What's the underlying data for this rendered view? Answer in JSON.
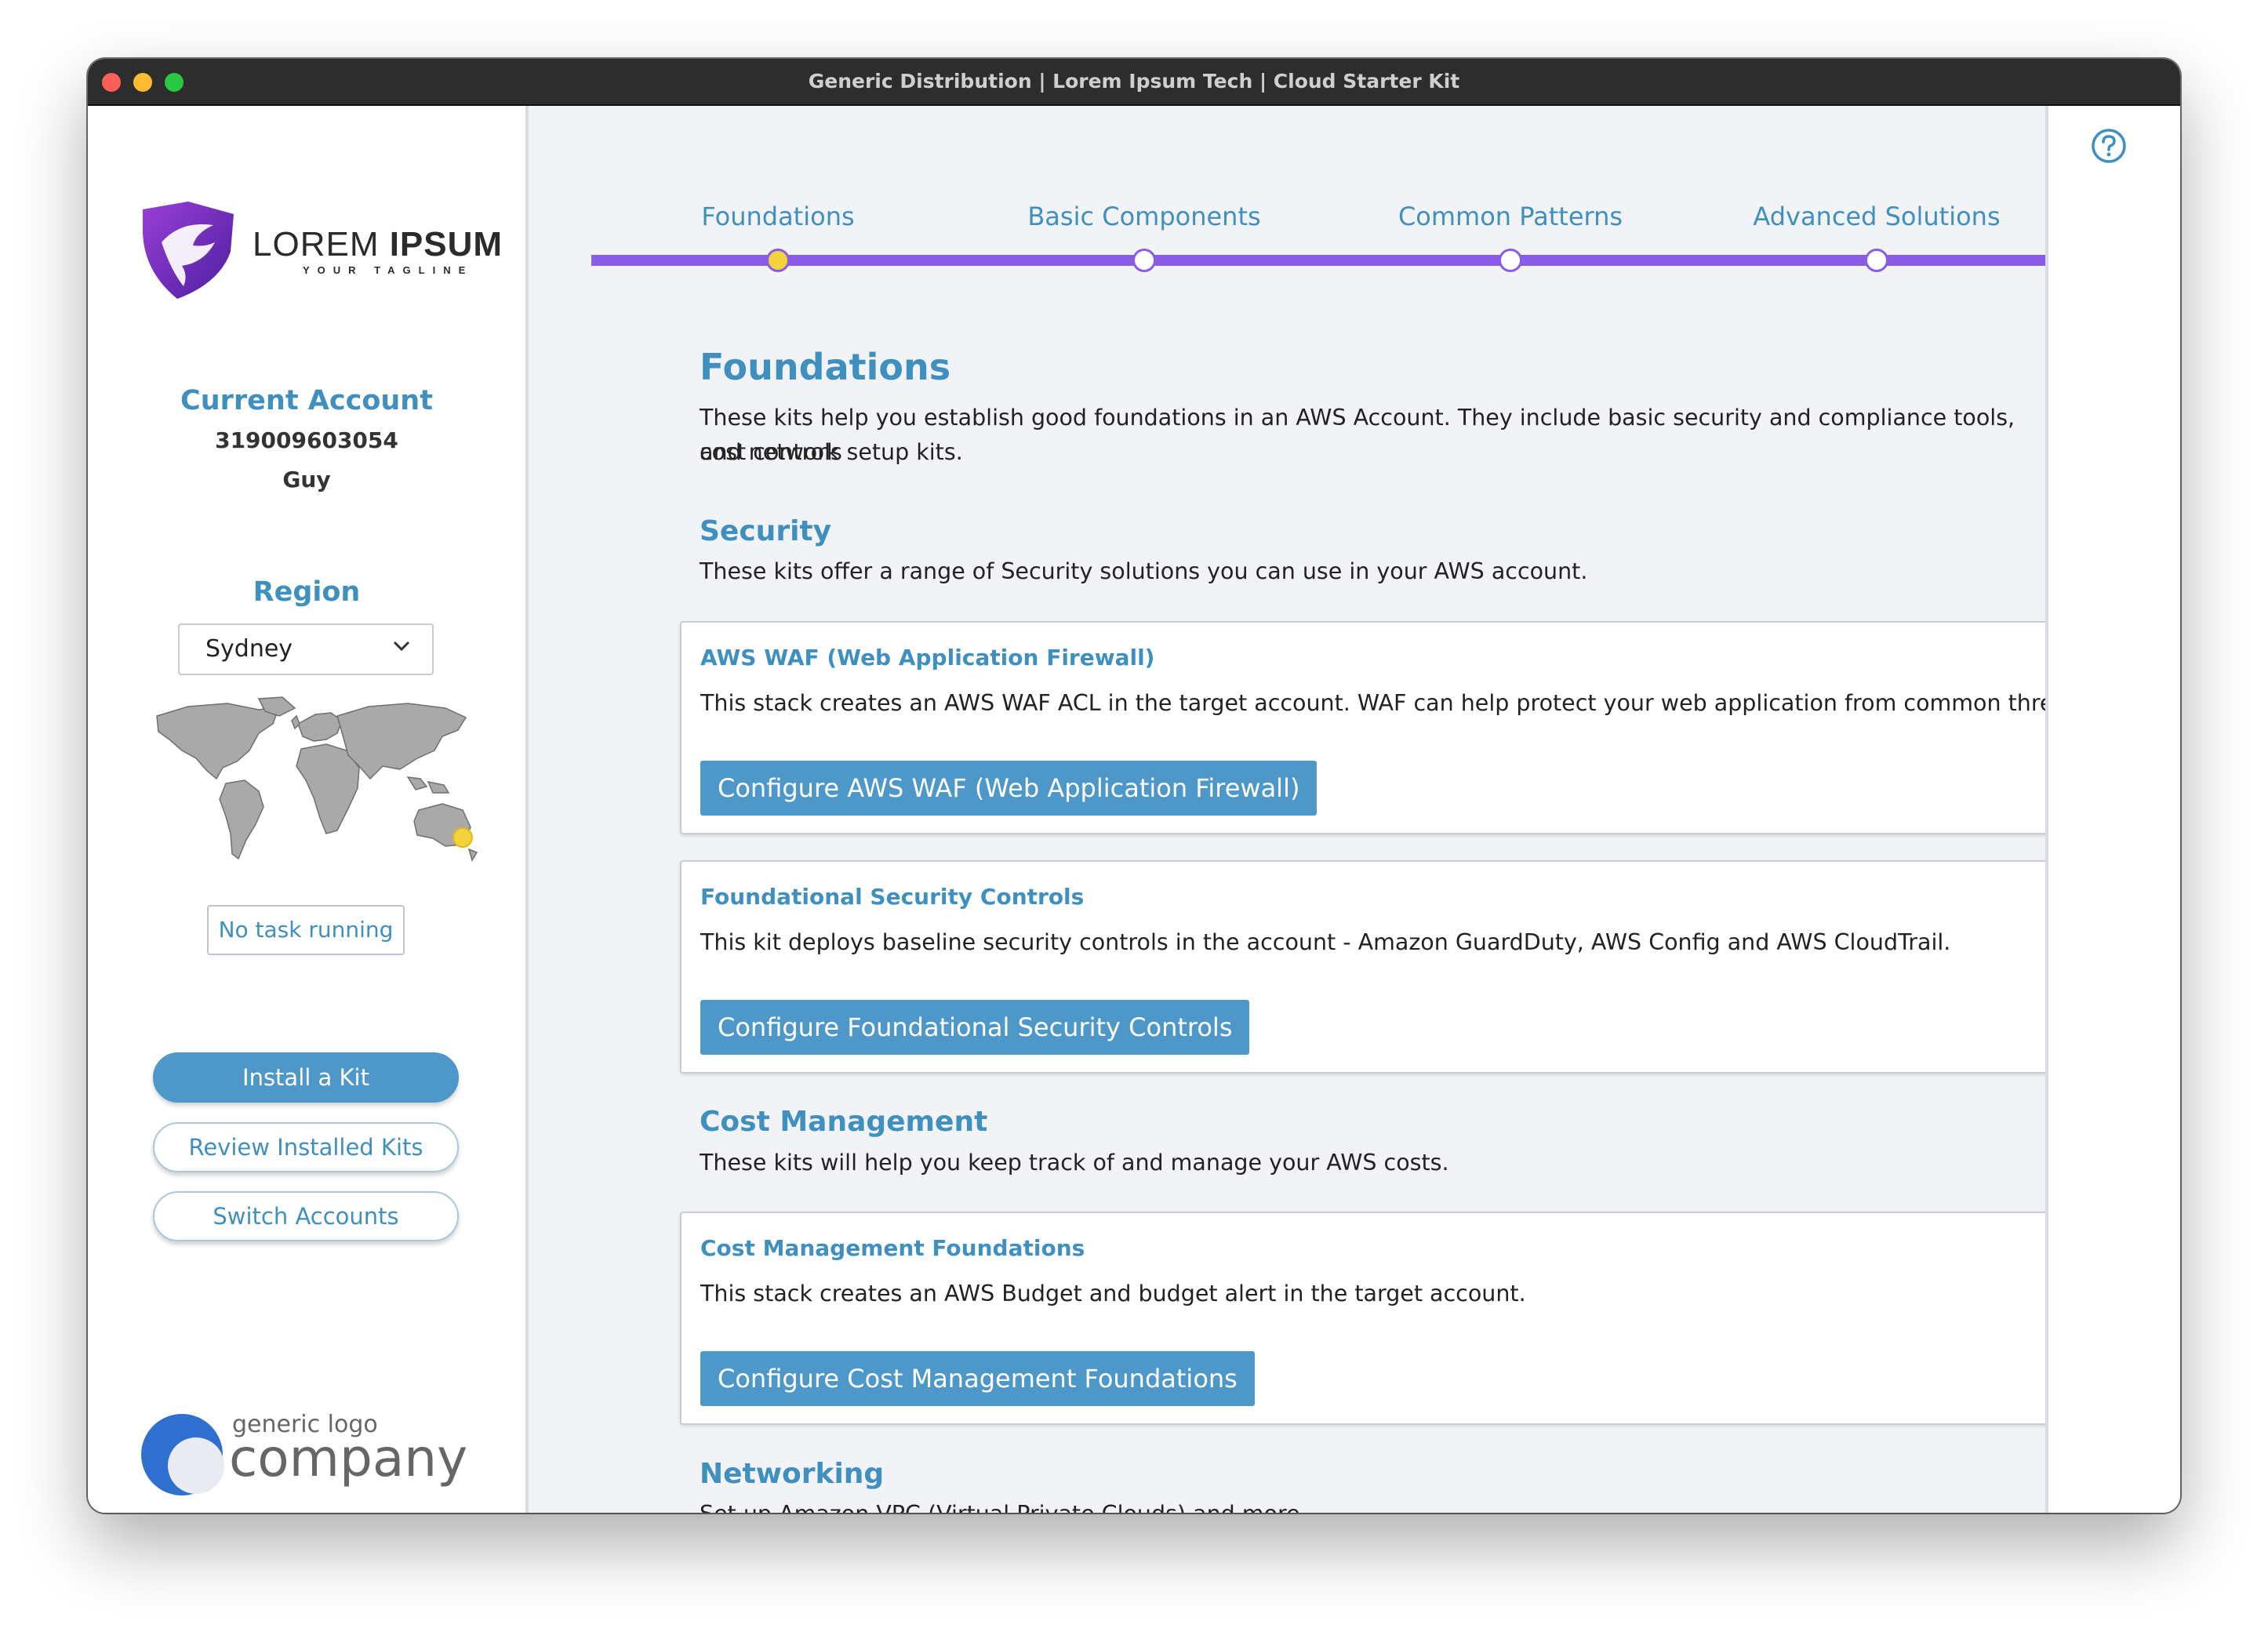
{
  "window": {
    "title": "Generic Distribution | Lorem Ipsum Tech | Cloud Starter Kit"
  },
  "brand": {
    "name_light": "LOREM ",
    "name_bold": "IPSUM",
    "tagline": "YOUR TAGLINE"
  },
  "account": {
    "title": "Current Account",
    "number": "319009603054",
    "name": "Guy"
  },
  "region": {
    "title": "Region",
    "selected": "Sydney",
    "highlight_color": "#f4d23c"
  },
  "status": {
    "text": "No task running"
  },
  "nav": {
    "install": "Install a Kit",
    "review": "Review Installed Kits",
    "switch": "Switch Accounts"
  },
  "company": {
    "line1": "generic logo",
    "line2": "company"
  },
  "stepper": {
    "steps": [
      "Foundations",
      "Basic Components",
      "Common Patterns",
      "Advanced Solutions"
    ],
    "active_index": 0,
    "track_color": "#8a5ce6"
  },
  "content": {
    "title": "Foundations",
    "intro_line1": "These kits help you establish good foundations in an AWS Account. They include basic security and compliance tools, cost controls",
    "intro_line2": "and network setup kits.",
    "sections": {
      "security": {
        "title": "Security",
        "desc": "These kits offer a range of Security solutions you can use in your AWS account.",
        "cards": [
          {
            "title": "AWS WAF (Web Application Firewall)",
            "desc": "This stack creates an AWS WAF ACL in the target account. WAF can help protect your web application from common threats.",
            "button": "Configure AWS WAF (Web Application Firewall)"
          },
          {
            "title": "Foundational Security Controls",
            "desc": "This kit deploys baseline security controls in the account - Amazon GuardDuty, AWS Config and AWS CloudTrail.",
            "button": "Configure Foundational Security Controls"
          }
        ]
      },
      "cost": {
        "title": "Cost Management",
        "desc": "These kits will help you keep track of and manage your AWS costs.",
        "cards": [
          {
            "title": "Cost Management Foundations",
            "desc": "This stack creates an AWS Budget and budget alert in the target account.",
            "button": "Configure Cost Management Foundations"
          }
        ]
      },
      "networking": {
        "title": "Networking",
        "desc": "Set up Amazon VPC (Virtual Private Clouds) and more."
      }
    }
  },
  "accent_color": "#3f8fbf",
  "button_color": "#4d98c9",
  "icons": {
    "help": "help-circle-icon",
    "dropdown": "chevron-down-icon"
  }
}
